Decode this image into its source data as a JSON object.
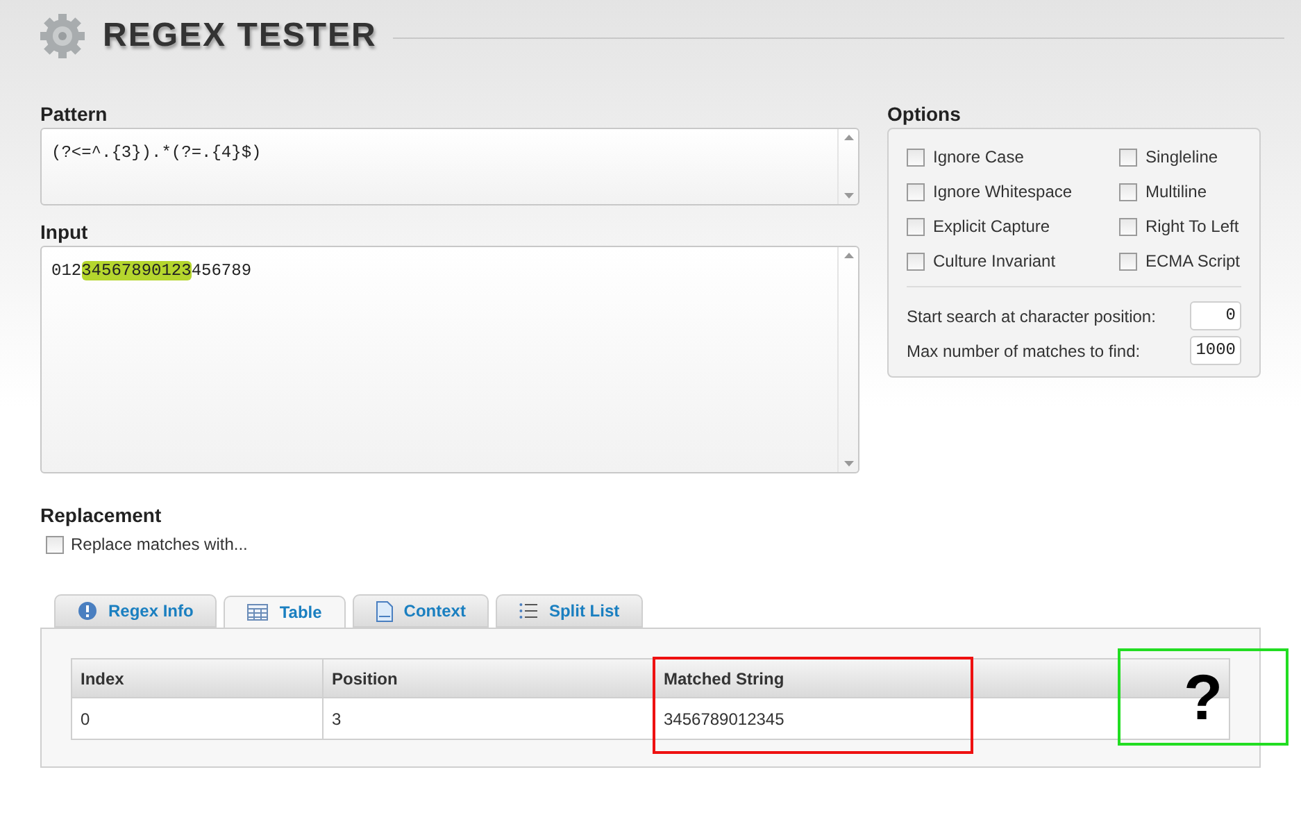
{
  "header": {
    "title": "REGEX TESTER"
  },
  "pattern": {
    "label": "Pattern",
    "value": "(?<=^.{3}).*(?=.{4}$)"
  },
  "input": {
    "label": "Input",
    "segments": [
      {
        "text": "012",
        "highlighted": false
      },
      {
        "text": "34567890123",
        "highlighted": true
      },
      {
        "text": "456789",
        "highlighted": false
      }
    ]
  },
  "options": {
    "label": "Options",
    "checkboxes": [
      {
        "label": "Ignore Case",
        "checked": false
      },
      {
        "label": "Singleline",
        "checked": false
      },
      {
        "label": "Ignore Whitespace",
        "checked": false
      },
      {
        "label": "Multiline",
        "checked": false
      },
      {
        "label": "Explicit Capture",
        "checked": false
      },
      {
        "label": "Right To Left",
        "checked": false
      },
      {
        "label": "Culture Invariant",
        "checked": false
      },
      {
        "label": "ECMA Script",
        "checked": false
      }
    ],
    "fields": [
      {
        "label": "Start search at character position:",
        "value": "0"
      },
      {
        "label": "Max number of matches to find:",
        "value": "1000"
      }
    ]
  },
  "replacement": {
    "label": "Replacement",
    "checkbox": {
      "label": "Replace matches with...",
      "checked": false
    }
  },
  "tabs": [
    {
      "label": "Regex Info",
      "kind": "info",
      "selected": false
    },
    {
      "label": "Table",
      "kind": "table",
      "selected": true
    },
    {
      "label": "Context",
      "kind": "document",
      "selected": false
    },
    {
      "label": "Split List",
      "kind": "list",
      "selected": false
    }
  ],
  "table": {
    "columns": [
      "Index",
      "Position",
      "Matched String"
    ],
    "rows": [
      [
        "0",
        "3",
        "3456789012345"
      ]
    ]
  },
  "annotations": [
    {
      "color": "#ee1111"
    },
    {
      "color": "#22dd22",
      "text": "?"
    }
  ]
}
